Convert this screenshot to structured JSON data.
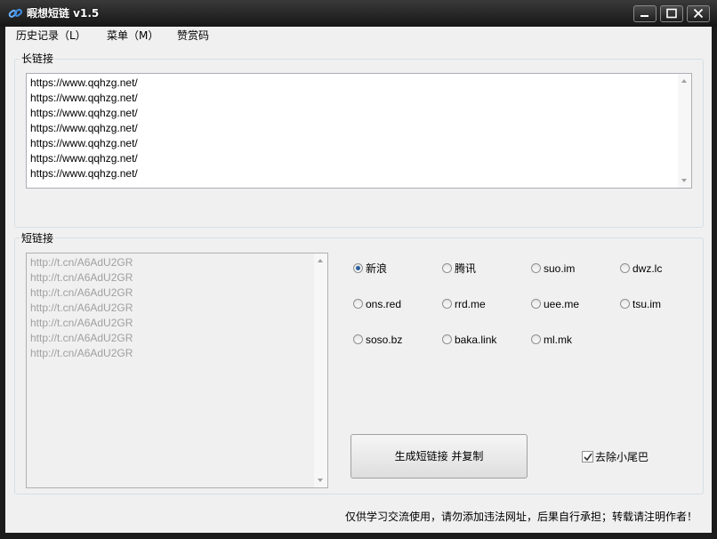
{
  "window": {
    "title": "暇想短链 v1.5",
    "app_icon": "chain-link-icon",
    "controls": [
      "minimize-icon",
      "maximize-icon",
      "close-icon"
    ]
  },
  "menu": {
    "history": "历史记录（L）",
    "menu": "菜单（M）",
    "donate": "赞赏码"
  },
  "long_link": {
    "label": "长链接",
    "lines": [
      "https://www.qqhzg.net/",
      "https://www.qqhzg.net/",
      "https://www.qqhzg.net/",
      "https://www.qqhzg.net/",
      "https://www.qqhzg.net/",
      "https://www.qqhzg.net/",
      "https://www.qqhzg.net/"
    ]
  },
  "short_link": {
    "label": "短链接",
    "lines": [
      "http://t.cn/A6AdU2GR",
      "http://t.cn/A6AdU2GR",
      "http://t.cn/A6AdU2GR",
      "http://t.cn/A6AdU2GR",
      "http://t.cn/A6AdU2GR",
      "http://t.cn/A6AdU2GR",
      "http://t.cn/A6AdU2GR"
    ]
  },
  "services": [
    {
      "label": "新浪",
      "selected": true
    },
    {
      "label": "腾讯",
      "selected": false
    },
    {
      "label": "suo.im",
      "selected": false
    },
    {
      "label": "dwz.lc",
      "selected": false
    },
    {
      "label": "ons.red",
      "selected": false
    },
    {
      "label": "rrd.me",
      "selected": false
    },
    {
      "label": "uee.me",
      "selected": false
    },
    {
      "label": "tsu.im",
      "selected": false
    },
    {
      "label": "soso.bz",
      "selected": false
    },
    {
      "label": "baka.link",
      "selected": false
    },
    {
      "label": "ml.mk",
      "selected": false
    }
  ],
  "generate_button": "生成短链接 并复制",
  "remove_tail": {
    "label": "去除小尾巴",
    "checked": true
  },
  "footer": "仅供学习交流使用，请勿添加违法网址，后果自行承担；转载请注明作者！",
  "colors": {
    "titlebar": "#1c1c1c",
    "client": "#f0f0f0",
    "radio_selected": "#2b5f9e"
  }
}
